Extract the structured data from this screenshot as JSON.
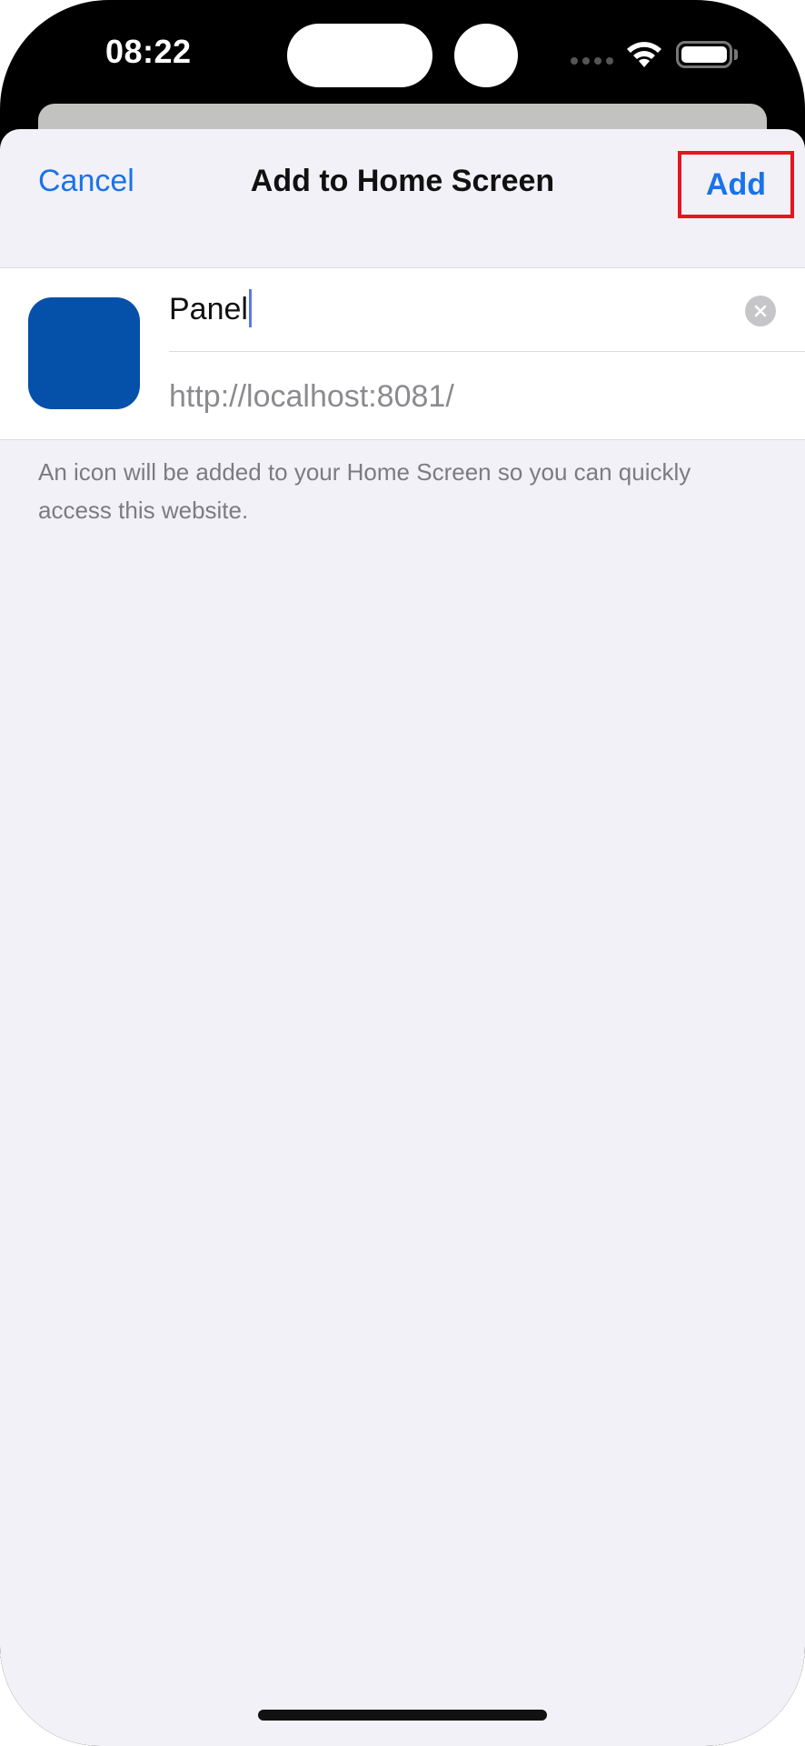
{
  "status_bar": {
    "time": "08:22",
    "icons": [
      "signal-dots-icon",
      "wifi-icon",
      "battery-icon"
    ]
  },
  "nav": {
    "cancel_label": "Cancel",
    "title": "Add to Home Screen",
    "add_label": "Add",
    "highlight_color": "#e8141e"
  },
  "form": {
    "app_icon_color": "#0550a8",
    "name_value": "Panel",
    "url": "http://localhost:8081/"
  },
  "hint": "An icon will be added to your Home Screen so you can quickly access this website.",
  "colors": {
    "accent": "#1a73e8",
    "background": "#f2f1f7"
  }
}
